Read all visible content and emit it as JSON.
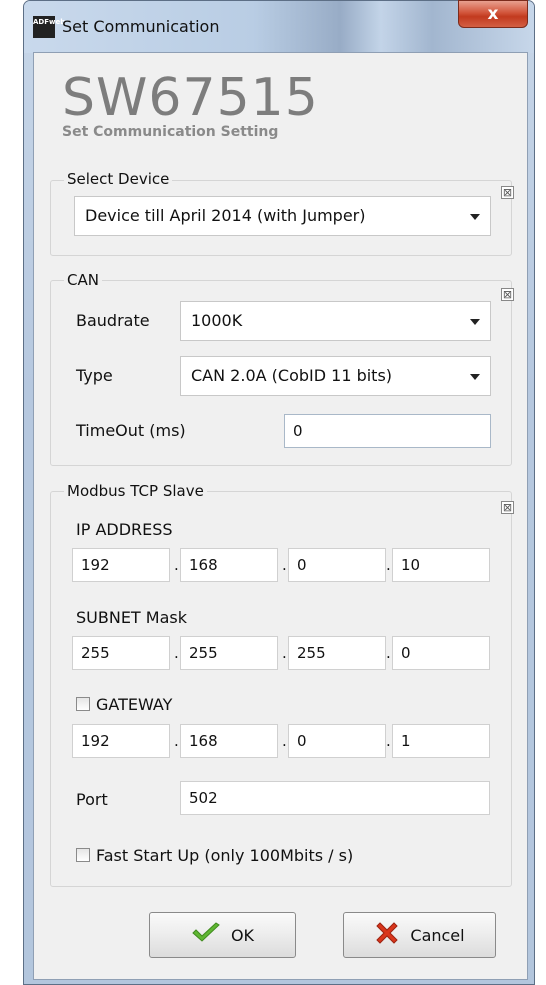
{
  "window": {
    "title": "Set Communication",
    "icon_text": "ADFweb",
    "close_symbol": "x"
  },
  "header": {
    "product": "SW67515",
    "subtitle": "Set Communication Setting"
  },
  "select_device": {
    "legend": "Select Device",
    "close_mark": "⊠",
    "selected": "Device till April 2014 (with Jumper)"
  },
  "can": {
    "legend": "CAN",
    "close_mark": "⊠",
    "baudrate_label": "Baudrate",
    "baudrate_value": "1000K",
    "type_label": "Type",
    "type_value": "CAN 2.0A (CobID 11 bits)",
    "timeout_label": "TimeOut (ms)",
    "timeout_value": "0"
  },
  "modbus": {
    "legend": "Modbus TCP Slave",
    "close_mark": "⊠",
    "ip_label": "IP ADDRESS",
    "ip": [
      "192",
      "168",
      "0",
      "10"
    ],
    "subnet_label": "SUBNET Mask",
    "subnet": [
      "255",
      "255",
      "255",
      "0"
    ],
    "gateway_label": "GATEWAY",
    "gateway_checked": false,
    "gateway": [
      "192",
      "168",
      "0",
      "1"
    ],
    "port_label": "Port",
    "port_value": "502",
    "fast_label": "Fast Start Up (only 100Mbits / s)",
    "fast_checked": false,
    "dot": "."
  },
  "buttons": {
    "ok": "OK",
    "cancel": "Cancel"
  },
  "colors": {
    "ok_check": "#5fb632",
    "cancel_x": "#d9361c"
  }
}
